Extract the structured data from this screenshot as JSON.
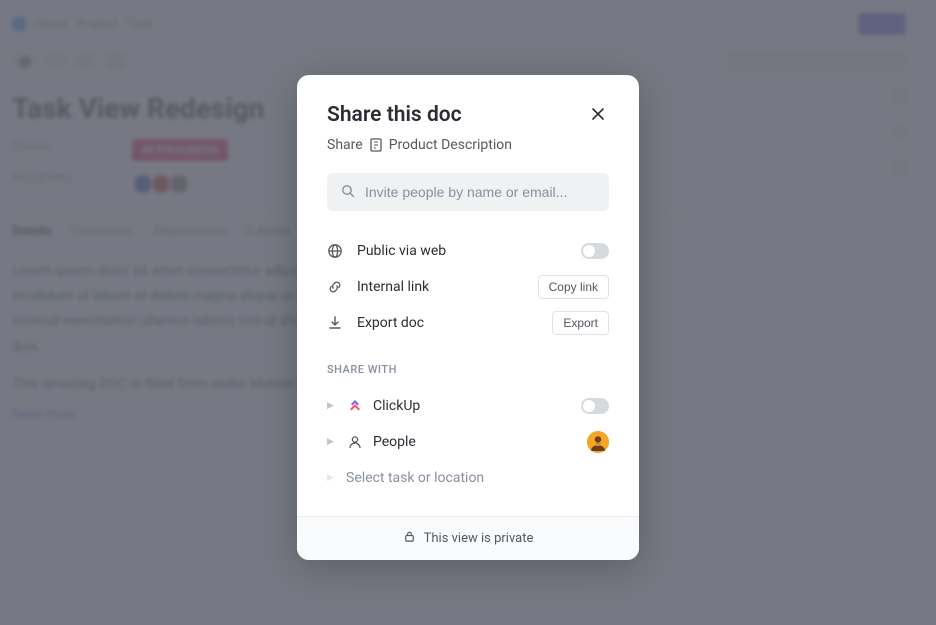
{
  "background": {
    "title": "Task View Redesign",
    "status_label": "Status",
    "status_badge": "IN PROGRESS",
    "assignees_label": "Assignees",
    "tabs": [
      "Details",
      "Comments",
      "Attachments",
      "Subtask"
    ]
  },
  "modal": {
    "title": "Share this doc",
    "breadcrumb_prefix": "Share",
    "breadcrumb_doc": "Product Description",
    "search_placeholder": "Invite people by name or email...",
    "options": {
      "public": {
        "label": "Public via web"
      },
      "internal": {
        "label": "Internal link",
        "action": "Copy link"
      },
      "export": {
        "label": "Export doc",
        "action": "Export"
      }
    },
    "share_with_label": "SHARE WITH",
    "share": {
      "clickup": {
        "label": "ClickUp"
      },
      "people": {
        "label": "People"
      },
      "select": {
        "label": "Select task or location"
      }
    },
    "footer": "This view is private"
  }
}
